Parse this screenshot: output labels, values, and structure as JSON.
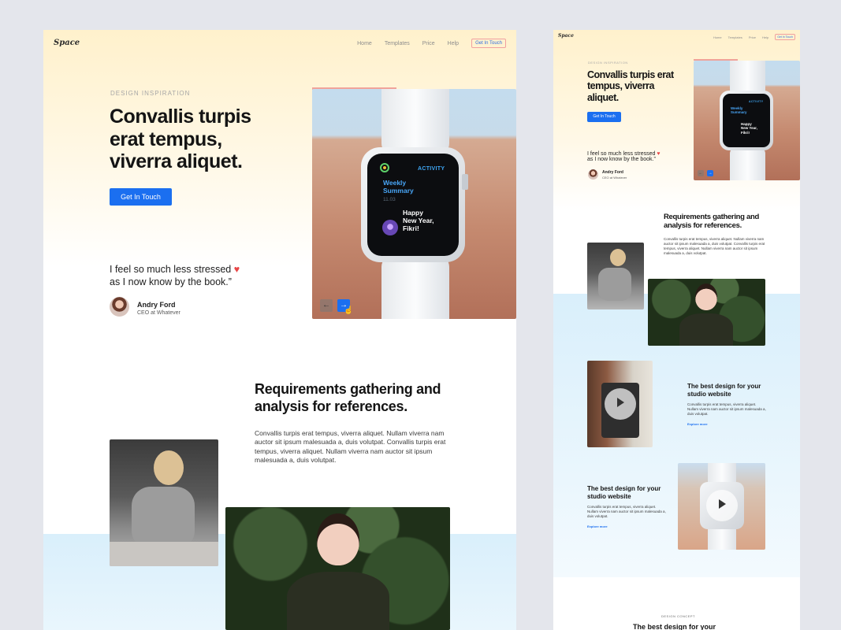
{
  "brand": {
    "logo": "Space",
    "accent": "#1b6ff0",
    "hero_tint": "#fff1cc",
    "sky_tint": "#d9effb"
  },
  "nav": {
    "items": [
      "Home",
      "Templates",
      "Price",
      "Help"
    ],
    "cta": "Get In Touch"
  },
  "hero": {
    "eyebrow": "DESIGN INSPIRATION",
    "title": "Convallis turpis erat tempus, viverra aliquet.",
    "cta": "Get In Touch",
    "quote_line1": "I feel so much less stressed",
    "quote_line2": "as I now know by the book.”",
    "person_name": "Andry Ford",
    "person_role": "CEO at Whatever",
    "watch": {
      "activity": "ACTIVITY",
      "summary_line1": "Weekly",
      "summary_line2": "Summary",
      "date": "11.03",
      "message_line1": "Happy",
      "message_line2": "New Year,",
      "message_line3": "Fikri!"
    },
    "arrows": {
      "prev_icon": "arrow-left-icon",
      "next_icon": "arrow-right-icon"
    }
  },
  "requirements": {
    "title": "Requirements gathering and analysis for references.",
    "text": "Convallis turpis erat tempus, viverra aliquet. Nullam viverra nam auctor sit ipsum malesuada a, duis volutpat. Convallis turpis erat tempus, viverra aliquet. Nullam viverra nam auctor sit ipsum malesuada a, duis volutpat."
  },
  "features": [
    {
      "title": "The best design for your studio website",
      "text": "Convallis turpis erat tempus, viverra aliquet. Nullam viverra nam auctor sit ipsum malesuada a, duis volutpat.",
      "link": "Explore more"
    },
    {
      "title": "The best design for your studio website",
      "text": "Convallis turpis erat tempus, viverra aliquet. Nullam viverra nam auctor sit ipsum malesuada a, duis volutpat.",
      "link": "Explore more"
    }
  ],
  "concept": {
    "eyebrow": "DESIGN CONCEPT",
    "title": "The best design for your"
  }
}
